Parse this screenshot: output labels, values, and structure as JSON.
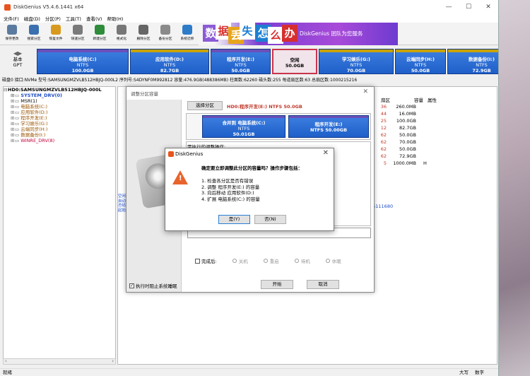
{
  "window": {
    "title": "DiskGenius V5.4.6.1441 x64"
  },
  "menu": [
    "文件(F)",
    "磁盘(D)",
    "分区(P)",
    "工具(T)",
    "查看(V)",
    "帮助(H)"
  ],
  "toolbar": {
    "items": [
      {
        "label": "保存更改",
        "icon": "save-icon",
        "color": "#5b7aa0"
      },
      {
        "label": "搜索分区",
        "icon": "search-icon",
        "color": "#3a6fb0"
      },
      {
        "label": "恢复文件",
        "icon": "recover-icon",
        "color": "#d79a1e"
      },
      {
        "label": "快速分区",
        "icon": "quick-partition-icon",
        "color": "#7a7a7a"
      },
      {
        "label": "新建分区",
        "icon": "new-partition-icon",
        "color": "#2f8c3a"
      },
      {
        "label": "格式化",
        "icon": "format-icon",
        "color": "#777777"
      },
      {
        "label": "删除分区",
        "icon": "delete-icon",
        "color": "#666666"
      },
      {
        "label": "备份分区",
        "icon": "backup-icon",
        "color": "#8a8a8a"
      },
      {
        "label": "系统迁移",
        "icon": "migrate-icon",
        "color": "#2d7cc9"
      }
    ]
  },
  "banner": {
    "words": [
      "数",
      "据",
      "丢",
      "失",
      "怎",
      "么",
      "办"
    ],
    "slogan": "DiskGenius 团队为您服务"
  },
  "disk": {
    "label": "基本\nGPT",
    "partitions": [
      {
        "name": "电脑系统(C:)",
        "fs": "NTFS",
        "size": "100.0GB",
        "kind": "normal"
      },
      {
        "name": "应用软件(D:)",
        "fs": "NTFS",
        "size": "82.7GB",
        "kind": "normal"
      },
      {
        "name": "程序开发(E:)",
        "fs": "NTFS",
        "size": "50.0GB",
        "kind": "normal"
      },
      {
        "name": "空闲",
        "fs": "",
        "size": "50.0GB",
        "kind": "free"
      },
      {
        "name": "学习娱乐(G:)",
        "fs": "NTFS",
        "size": "70.0GB",
        "kind": "normal"
      },
      {
        "name": "云端同步(H:)",
        "fs": "NTFS",
        "size": "50.0GB",
        "kind": "normal"
      },
      {
        "name": "数据备份(I:)",
        "fs": "NTFS",
        "size": "72.9GB",
        "kind": "normal"
      }
    ]
  },
  "diskinfo": "磁盘0 接口:NVMe  型号:SAMSUNGMZVLB512HBJQ-000L2  序列号:S4DYNF0M992812  容量:476.9GB(488386MB)  柱面数:62260  磁头数:255  每道扇区数:63  总扇区数:1000215216",
  "tree": {
    "disk": "HD0:SAMSUNGMZVLB512HBJQ-000L",
    "items": [
      {
        "label": "SYSTEM_DRV(0)",
        "style": "blue"
      },
      {
        "label": "MSR(1)",
        "style": "plain"
      },
      {
        "label": "电脑系统(C:)",
        "style": "orange"
      },
      {
        "label": "应用软件(D:)",
        "style": "orange"
      },
      {
        "label": "程序开发(E:)",
        "style": "orange"
      },
      {
        "label": "学习娱乐(G:)",
        "style": "orange"
      },
      {
        "label": "云端同步(H:)",
        "style": "orange"
      },
      {
        "label": "数据备份(I:)",
        "style": "orange"
      },
      {
        "label": "WINRE_DRV(8)",
        "style": "red"
      }
    ]
  },
  "table": {
    "headers": [
      "扇区",
      "容量",
      "属性"
    ],
    "rows": [
      {
        "n": "36",
        "cap": "260.0MB",
        "attr": ""
      },
      {
        "n": "44",
        "cap": "16.0MB",
        "attr": ""
      },
      {
        "n": "25",
        "cap": "100.0GB",
        "attr": ""
      },
      {
        "n": "12",
        "cap": "82.7GB",
        "attr": ""
      },
      {
        "n": "62",
        "cap": "50.0GB",
        "attr": ""
      },
      {
        "n": "62",
        "cap": "70.0GB",
        "attr": ""
      },
      {
        "n": "62",
        "cap": "50.0GB",
        "attr": ""
      },
      {
        "n": "62",
        "cap": "72.9GB",
        "attr": ""
      },
      {
        "n": "5",
        "cap": "1000.0MB",
        "attr": "H"
      }
    ],
    "sector_total": "95111680"
  },
  "resize_dialog": {
    "title": "调整分区容量",
    "select_btn": "选择分区",
    "select_info": "HD0:程序开发(E:) NTFS 50.0GB",
    "merge_left": {
      "name": "合并到 电脑系统(C:)",
      "fs": "NTFS",
      "size": "50.01GB"
    },
    "merge_right": {
      "name": "程序开发(E:)",
      "fs": "NTFS 50.00GB"
    },
    "ops_label": "需执行的调整操作:",
    "finish_label": "完成后:",
    "options": [
      "关机",
      "重启",
      "待机",
      "休眠"
    ],
    "no_sleep": "执行时阻止系统睡眠",
    "start": "开始",
    "cancel": "取消",
    "side_labels": [
      "空闲",
      "自动",
      "总结",
      "起始"
    ]
  },
  "confirm": {
    "title": "DiskGenius",
    "question": "确定要立即调整此分区的容量吗？操作步骤包括：",
    "steps": [
      "1. 检查各分区是否有错误",
      "2. 调整 程序开发(E:) 的容量",
      "3. 向后移动 应用软件(D:)",
      "4. 扩展 电脑系统(C:) 的容量"
    ],
    "yes": "是(Y)",
    "no": "否(N)"
  },
  "status": {
    "left": "就绪",
    "caps": "大写",
    "num": "数字"
  }
}
